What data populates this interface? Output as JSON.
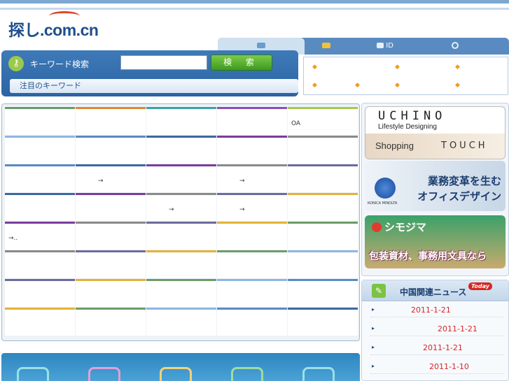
{
  "header": {
    "logo_text": "探し.com.cn",
    "tabs": [
      {
        "label": ""
      },
      {
        "label": ""
      },
      {
        "label": "ID"
      },
      {
        "label": ""
      }
    ]
  },
  "search": {
    "label": "キーワード検索",
    "input_value": "",
    "button_label": "検 索",
    "attention_label": "注目のキーワード"
  },
  "news_box": {
    "items": [
      "",
      "",
      "",
      "",
      "",
      "",
      ""
    ]
  },
  "category_grid": {
    "rows": [
      [
        "",
        "",
        "",
        "",
        "OA"
      ],
      [
        "",
        "",
        "",
        "",
        ""
      ],
      [
        "",
        "→",
        "",
        "→",
        ""
      ],
      [
        "",
        "",
        "→",
        "→",
        ""
      ],
      [
        "→..",
        "",
        "",
        "",
        ""
      ],
      [
        "",
        "",
        "",
        "",
        ""
      ],
      [
        "",
        "",
        "",
        "",
        ""
      ],
      [
        "",
        "",
        "",
        "",
        ""
      ]
    ],
    "colors": [
      "#6c9c6a",
      "#e0872e",
      "#3aa3a0",
      "#8d4fb0",
      "#a7c94a"
    ]
  },
  "banners": {
    "uchino": {
      "brand": "UCHINO",
      "tagline": "Lifestyle Designing",
      "shopping": "Shopping",
      "touch": "TOUCH"
    },
    "konica": {
      "brand": "KONICA MINOLTA",
      "line1": "業務変革を生む",
      "line2": "オフィスデザイン"
    },
    "shimojima": {
      "brand": "シモジマ",
      "line": "包装資材、事務用文具なら"
    }
  },
  "china_news": {
    "title": "中国関連ニュース",
    "badge": "Today",
    "items": [
      {
        "date": "2011-1-21"
      },
      {
        "date": "2011-1-21"
      },
      {
        "date": "2011-1-21"
      },
      {
        "date": "2011-1-10"
      }
    ]
  }
}
